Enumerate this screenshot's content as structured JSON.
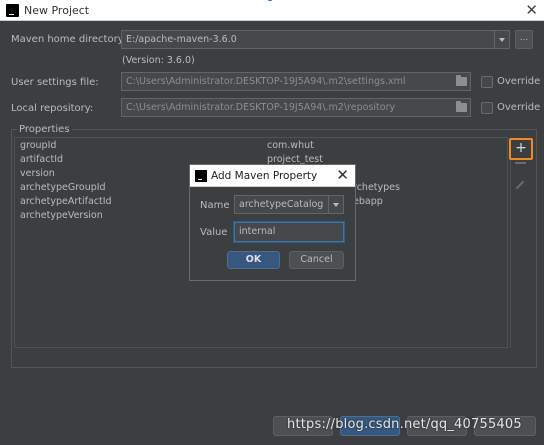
{
  "window": {
    "title": "New Project",
    "close_glyph": "✕"
  },
  "maven": {
    "home_label": "Maven home directory:",
    "home_value": "E:/apache-maven-3.6.0",
    "browse_label": "...",
    "version_text": "(Version: 3.6.0)",
    "settings_label": "User settings file:",
    "settings_value": "C:\\Users\\Administrator.DESKTOP-19J5A94\\.m2\\settings.xml",
    "repo_label": "Local repository:",
    "repo_value": "C:\\Users\\Administrator.DESKTOP-19J5A94\\.m2\\repository",
    "override_label": "Override"
  },
  "properties": {
    "title": "Properties",
    "rows": [
      {
        "key": "groupId",
        "value": "com.whut"
      },
      {
        "key": "artifactId",
        "value": "project_test"
      },
      {
        "key": "version",
        "value": ""
      },
      {
        "key": "archetypeGroupId",
        "value": "rchetypes"
      },
      {
        "key": "archetypeArtifactId",
        "value": "ebapp"
      },
      {
        "key": "archetypeVersion",
        "value": ""
      }
    ],
    "add_glyph": "+"
  },
  "dialog": {
    "title": "Add Maven Property",
    "close_glyph": "✕",
    "name_label": "Name",
    "name_value": "archetypeCatalog",
    "value_label": "Value",
    "value_value": "internal",
    "ok_label": "OK",
    "cancel_label": "Cancel"
  },
  "footer": {
    "watermark": "https://blog.csdn.net/qq_40755405"
  },
  "icons": {
    "app": "intellij-icon",
    "folder": "folder-icon",
    "dropdown": "chevron-down-icon"
  }
}
